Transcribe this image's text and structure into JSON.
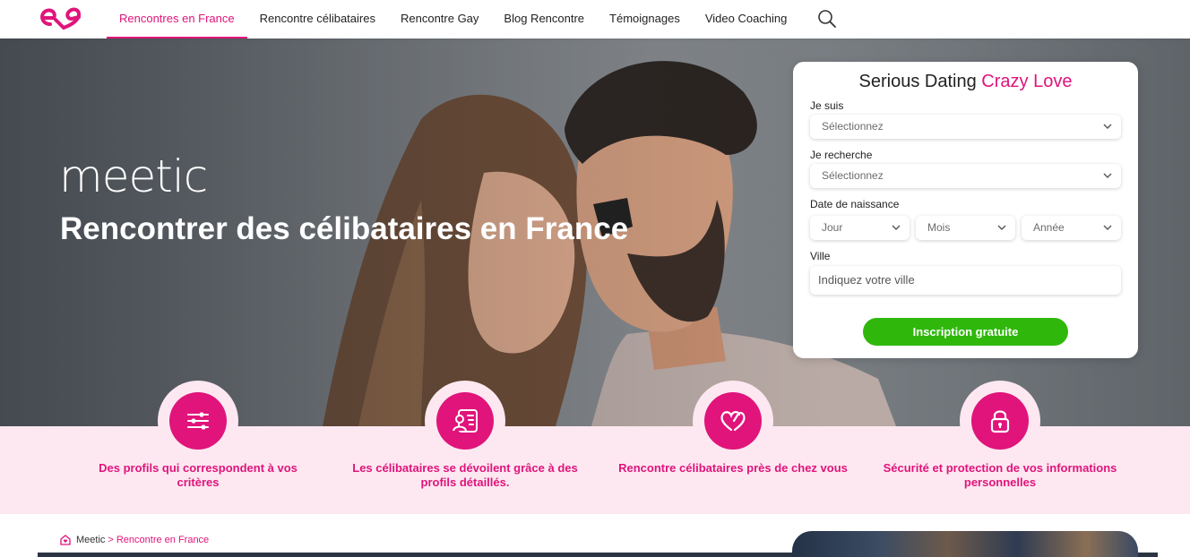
{
  "nav": {
    "items": [
      {
        "label": "Rencontres en France",
        "active": true
      },
      {
        "label": "Rencontre célibataires",
        "active": false
      },
      {
        "label": "Rencontre Gay",
        "active": false
      },
      {
        "label": "Blog Rencontre",
        "active": false
      },
      {
        "label": "Témoignages",
        "active": false
      },
      {
        "label": "Video Coaching",
        "active": false
      }
    ],
    "search_icon": "search-icon",
    "logo_icon": "heart-logo-icon"
  },
  "hero": {
    "brand": "meetic",
    "title": "Rencontrer des célibataires en France"
  },
  "form": {
    "title_main": "Serious Dating",
    "title_accent": "Crazy Love",
    "je_suis_label": "Je suis",
    "je_suis_value": "Sélectionnez",
    "je_recherche_label": "Je recherche",
    "je_recherche_value": "Sélectionnez",
    "birth_label": "Date de naissance",
    "day": "Jour",
    "month": "Mois",
    "year": "Année",
    "city_label": "Ville",
    "city_placeholder": "Indiquez votre ville",
    "submit": "Inscription gratuite"
  },
  "features": [
    {
      "icon": "sliders-icon",
      "text": "Des profils qui correspondent à vos critères"
    },
    {
      "icon": "profile-card-icon",
      "text": "Les célibataires se dévoilent grâce à des profils détaillés."
    },
    {
      "icon": "double-heart-icon",
      "text": "Rencontre célibataires près de chez vous"
    },
    {
      "icon": "lock-icon",
      "text": "Sécurité et protection de vos informations personnelles"
    }
  ],
  "breadcrumb": {
    "home": "Meetic",
    "separator": ">",
    "current": "Rencontre en France"
  },
  "colors": {
    "accent": "#e0147b",
    "cta": "#2fb80b",
    "band": "#fde8f1"
  }
}
